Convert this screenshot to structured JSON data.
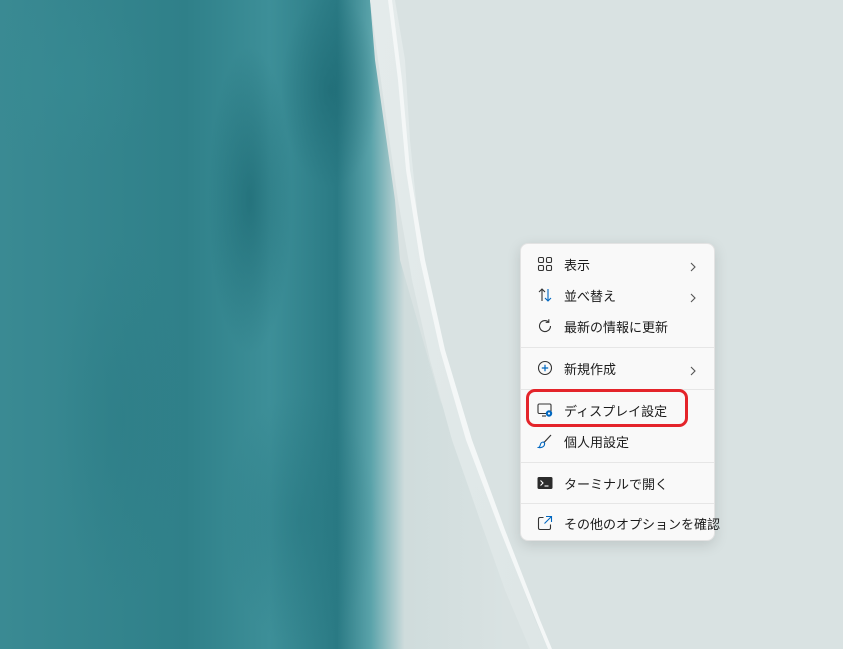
{
  "desktop": {
    "wallpaper": "teal-sea-and-shore"
  },
  "context_menu": {
    "items": [
      {
        "label": "表示",
        "icon": "grid-view-icon",
        "submenu": true
      },
      {
        "label": "並べ替え",
        "icon": "sort-arrows-icon",
        "submenu": true
      },
      {
        "label": "最新の情報に更新",
        "icon": "refresh-icon",
        "submenu": false
      },
      {
        "label": "新規作成",
        "icon": "plus-circle-icon",
        "submenu": true
      },
      {
        "label": "ディスプレイ設定",
        "icon": "display-settings-icon",
        "submenu": false
      },
      {
        "label": "個人用設定",
        "icon": "brush-icon",
        "submenu": false
      },
      {
        "label": "ターミナルで開く",
        "icon": "terminal-icon",
        "submenu": false
      },
      {
        "label": "その他のオプションを確認",
        "icon": "external-link-icon",
        "submenu": false
      }
    ]
  },
  "annotation": {
    "highlighted_item": "ディスプレイ設定",
    "color": "#e4242a"
  },
  "colors": {
    "menu_bg": "#f9f9f9",
    "text": "#1b1b1b",
    "accent_blue": "#0067c0"
  }
}
